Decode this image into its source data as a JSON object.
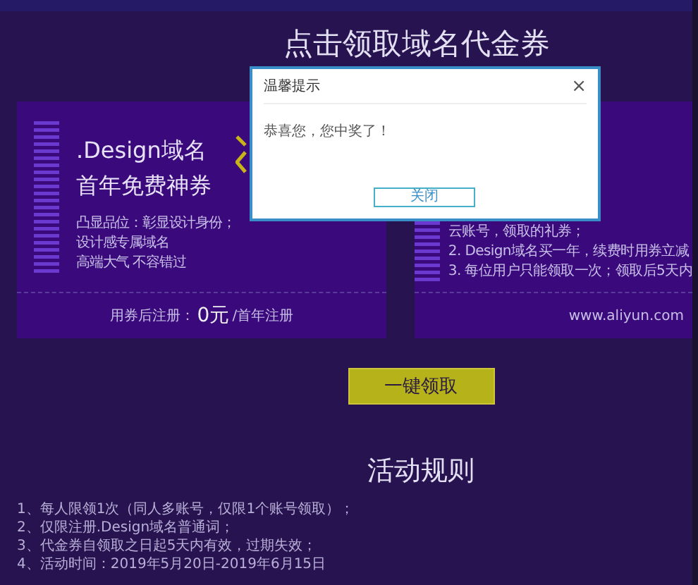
{
  "page": {
    "title": "点击领取域名代金券"
  },
  "coupons": [
    {
      "kind": "offer",
      "heading": ".Design域名",
      "subheading": "首年免费神券",
      "lines": [
        "凸显品位：彰显设计身份；",
        "设计感专属域名",
        "高端大气 不容错过"
      ],
      "price_label": "用券后注册：",
      "price": "0元",
      "price_unit": "/首年注册"
    },
    {
      "kind": "terms",
      "lines": [
        "云账号，领取的礼券；",
        "2. Design域名买一年，续费时用券立减",
        "3. 每位用户只能领取一次；领取后5天内"
      ],
      "site": "www.aliyun.com"
    }
  ],
  "claim_button": "一键领取",
  "rules": {
    "title": "活动规则",
    "items": [
      "1、每人限领1次（同人多账号，仅限1个账号领取）；",
      "2、仅限注册.Design域名普通词；",
      "3、代金券自领取之日起5天内有效，过期失效；",
      "4、活动时间：2019年5月20日-2019年6月15日"
    ]
  },
  "dialog": {
    "title": "温馨提示",
    "close": "×",
    "message": "恭喜您，您中奖了！",
    "button": "关闭"
  }
}
